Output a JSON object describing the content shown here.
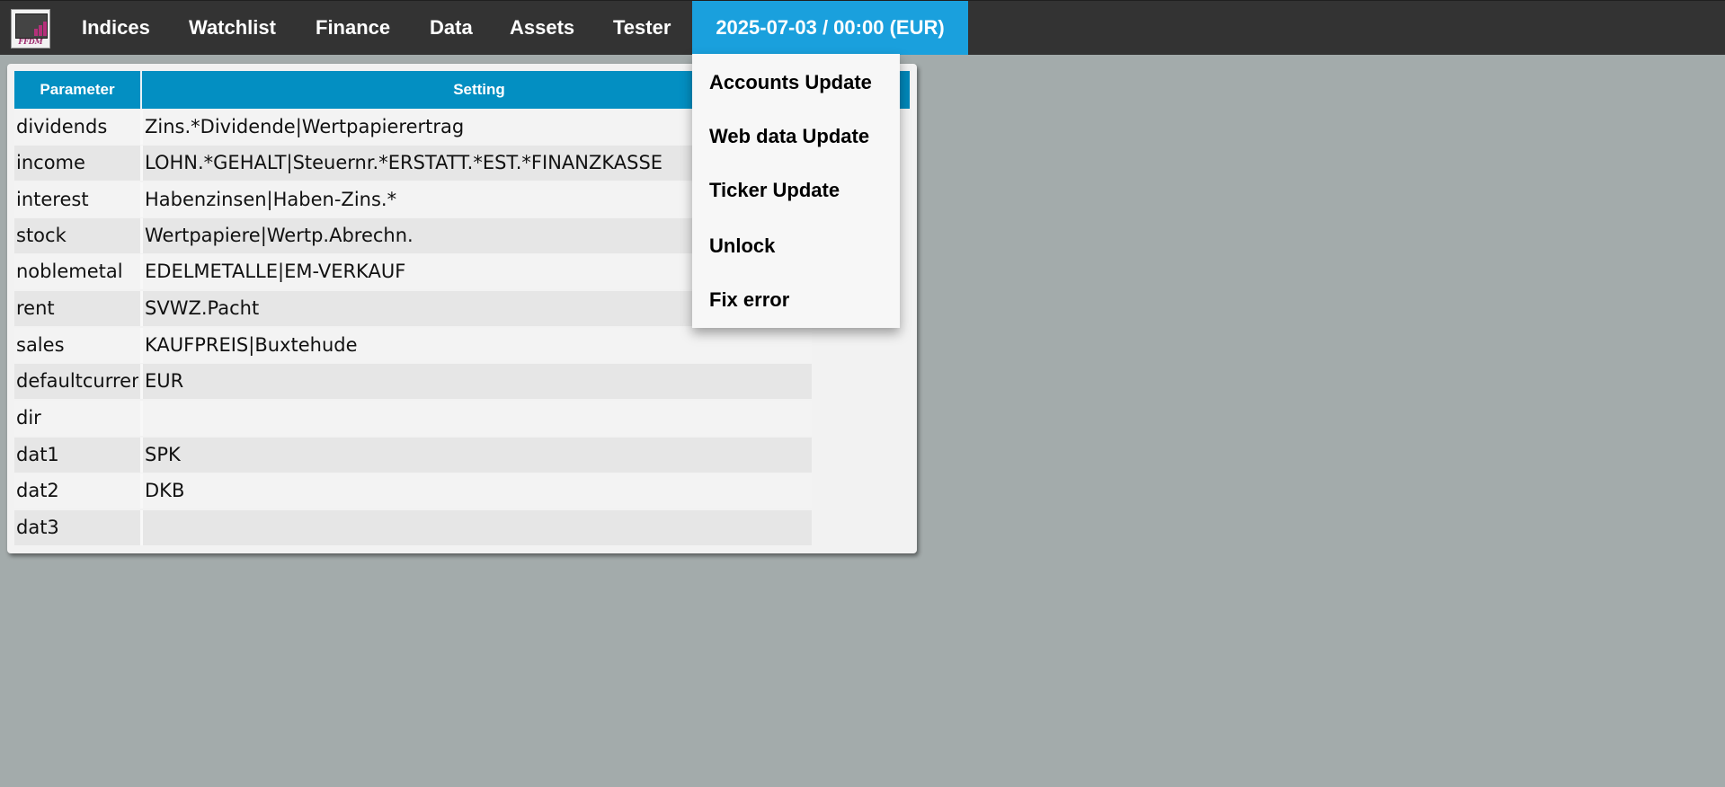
{
  "nav": {
    "items": [
      "Indices",
      "Watchlist",
      "Finance",
      "Data",
      "Assets",
      "Tester"
    ],
    "active_label": "2025-07-03 / 00:00 (EUR)",
    "logo_text": "FFDM"
  },
  "dropdown": {
    "items": [
      "Accounts Update",
      "Web data Update",
      "Ticker Update",
      "Unlock",
      "Fix error"
    ]
  },
  "table": {
    "headers": [
      "Parameter",
      "Setting"
    ],
    "rows": [
      {
        "param": "dividends",
        "setting": "Zins.*Dividende|Wertpapierertrag"
      },
      {
        "param": "income",
        "setting": "LOHN.*GEHALT|Steuernr.*ERSTATT.*EST.*FINANZKASSE"
      },
      {
        "param": "interest",
        "setting": "Habenzinsen|Haben-Zins.*"
      },
      {
        "param": "stock",
        "setting": "Wertpapiere|Wertp.Abrechn."
      },
      {
        "param": "noblemetal",
        "setting": "EDELMETALLE|EM-VERKAUF"
      },
      {
        "param": "rent",
        "setting": "SVWZ.Pacht"
      },
      {
        "param": "sales",
        "setting": "KAUFPREIS|Buxtehude"
      },
      {
        "param": "defaultcurren",
        "setting": "EUR"
      },
      {
        "param": "dir",
        "setting": ""
      },
      {
        "param": "dat1",
        "setting": "SPK"
      },
      {
        "param": "dat2",
        "setting": "DKB"
      },
      {
        "param": "dat3",
        "setting": ""
      }
    ]
  },
  "colors": {
    "navbar": "#333333",
    "active_tab": "#1aa0dd",
    "table_header": "#038fc2",
    "background": "#a3abab"
  }
}
